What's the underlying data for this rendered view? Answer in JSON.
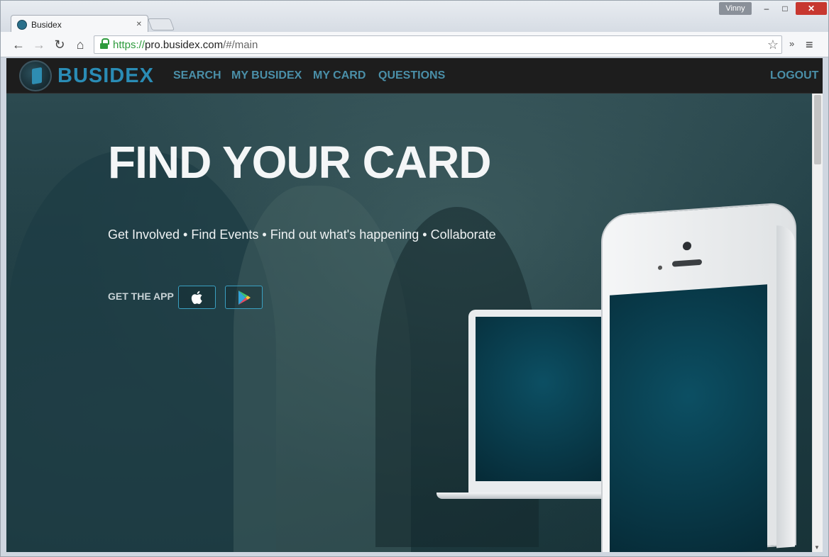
{
  "browser": {
    "tab_title": "Busidex",
    "tab_close": "×",
    "user_name": "Vinny",
    "url_scheme": "https://",
    "url_host": "pro.busidex.com",
    "url_path": "/#/main",
    "controls": {
      "back": "←",
      "forward": "→",
      "reload": "↻",
      "home": "⌂",
      "bookmark": "☆",
      "extensions": "»",
      "menu": "≡",
      "minimize": "–",
      "maximize": "□",
      "close": "✕"
    }
  },
  "site": {
    "brand": "BUSIDEX",
    "nav": {
      "search": "SEARCH",
      "my_busidex": "MY BUSIDEX",
      "my_card": "MY CARD",
      "questions": "QUESTIONS",
      "logout": "LOGOUT"
    },
    "hero": {
      "title": "FIND YOUR CARD",
      "subtitle": "Get Involved • Find Events • Find out what's happening • Collaborate",
      "get_app": "GET THE APP"
    },
    "icons": {
      "apple": "apple-store-icon",
      "google_play": "google-play-icon"
    }
  },
  "colors": {
    "nav_bg": "#1d1d1d",
    "brand": "#2a8cb5",
    "nav_link": "#4a8fa8",
    "hero_bg": "#1f3d44",
    "ssl_green": "#2d9a3c"
  }
}
